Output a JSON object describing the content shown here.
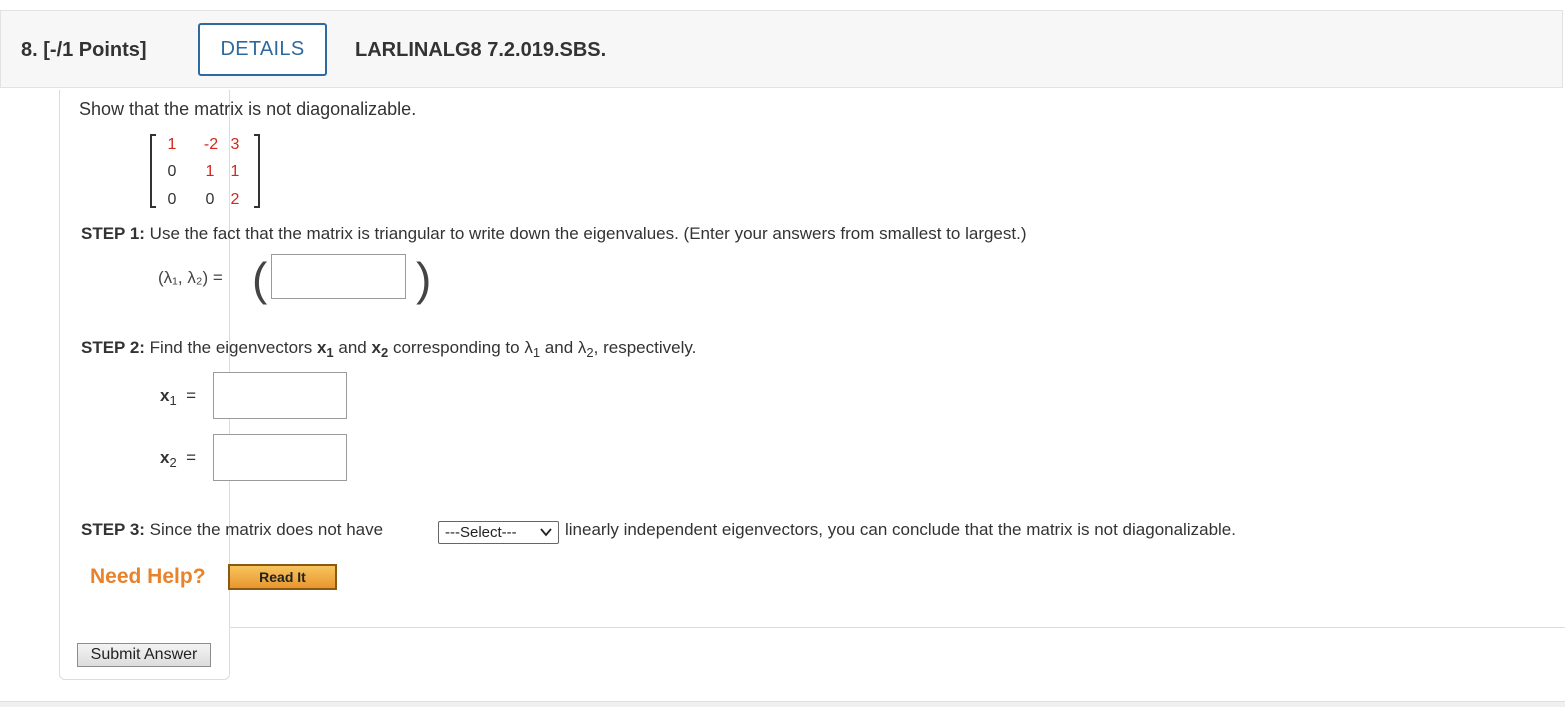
{
  "header": {
    "question_number": "8.",
    "points": "[-/1 Points]",
    "details_label": "DETAILS",
    "problem_code": "LARLINALG8 7.2.019.SBS."
  },
  "prompt": "Show that the matrix is not diagonalizable.",
  "matrix": {
    "rows": [
      [
        "1",
        "-2",
        "3"
      ],
      [
        "0",
        "1",
        "1"
      ],
      [
        "0",
        "0",
        "2"
      ]
    ]
  },
  "step1": {
    "label": "STEP 1:",
    "text": "Use the fact that the matrix is triangular to write down the eigenvalues. (Enter your answers from smallest to largest.)",
    "lambda_pair_label": "(λ₁, λ₂) =",
    "answer_value": ""
  },
  "step2": {
    "label": "STEP 2:",
    "text_prefix": "Find the eigenvectors",
    "x1": "x",
    "and1": "and",
    "x2": "x",
    "corresponding": "corresponding to",
    "lambda": "λ",
    "and2": "and",
    "respectively": "respectively.",
    "x1_value": "",
    "x2_value": ""
  },
  "step3": {
    "label": "STEP 3:",
    "text_before": "Since the matrix does not have",
    "select_value": "---Select---",
    "text_after": "linearly independent eigenvectors, you can conclude that the matrix is not diagonalizable."
  },
  "help": {
    "need_help": "Need Help?",
    "read_it": "Read It"
  },
  "submit_label": "Submit Answer",
  "colors": {
    "accent_blue": "#2d6aa0",
    "matrix_red": "#d0281d",
    "help_orange": "#e8822b"
  }
}
